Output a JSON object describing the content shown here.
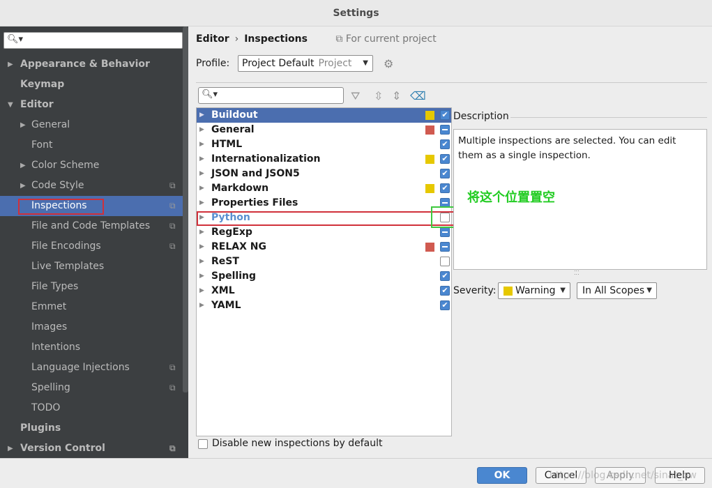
{
  "window": {
    "title": "Settings"
  },
  "sidebar": {
    "items": [
      {
        "label": "Appearance & Behavior"
      },
      {
        "label": "Keymap"
      },
      {
        "label": "Editor"
      },
      {
        "label": "General"
      },
      {
        "label": "Font"
      },
      {
        "label": "Color Scheme"
      },
      {
        "label": "Code Style"
      },
      {
        "label": "Inspections"
      },
      {
        "label": "File and Code Templates"
      },
      {
        "label": "File Encodings"
      },
      {
        "label": "Live Templates"
      },
      {
        "label": "File Types"
      },
      {
        "label": "Emmet"
      },
      {
        "label": "Images"
      },
      {
        "label": "Intentions"
      },
      {
        "label": "Language Injections"
      },
      {
        "label": "Spelling"
      },
      {
        "label": "TODO"
      },
      {
        "label": "Plugins"
      },
      {
        "label": "Version Control"
      }
    ]
  },
  "header": {
    "crumb_parent": "Editor",
    "crumb_current": "Inspections",
    "scope_note": "For current project"
  },
  "profile": {
    "label": "Profile:",
    "value": "Project Default",
    "sub": "Project"
  },
  "tree": {
    "rows": [
      {
        "name": "Buildout",
        "severity": "#e6c800",
        "state": "on"
      },
      {
        "name": "General",
        "severity": "#d05a50",
        "state": "partial"
      },
      {
        "name": "HTML",
        "severity": "",
        "state": "on"
      },
      {
        "name": "Internationalization",
        "severity": "#e6c800",
        "state": "on"
      },
      {
        "name": "JSON and JSON5",
        "severity": "",
        "state": "on"
      },
      {
        "name": "Markdown",
        "severity": "#e6c800",
        "state": "on"
      },
      {
        "name": "Properties Files",
        "severity": "",
        "state": "partial"
      },
      {
        "name": "Python",
        "severity": "",
        "state": "off"
      },
      {
        "name": "RegExp",
        "severity": "",
        "state": "partial"
      },
      {
        "name": "RELAX NG",
        "severity": "#d05a50",
        "state": "partial"
      },
      {
        "name": "ReST",
        "severity": "",
        "state": "off"
      },
      {
        "name": "Spelling",
        "severity": "",
        "state": "on"
      },
      {
        "name": "XML",
        "severity": "",
        "state": "on"
      },
      {
        "name": "YAML",
        "severity": "",
        "state": "on"
      }
    ]
  },
  "description": {
    "label": "Description",
    "text": "Multiple inspections are selected. You can edit them as a single inspection."
  },
  "annotation": "将这个位置置空",
  "severity": {
    "label": "Severity:",
    "value": "Warning",
    "scope": "In All Scopes"
  },
  "disable_new": {
    "label": "Disable new inspections by default"
  },
  "buttons": {
    "ok": "OK",
    "cancel": "Cancel",
    "apply": "Apply",
    "help": "Help"
  },
  "watermark": "https://blog.csdn.net/sinat_ow"
}
